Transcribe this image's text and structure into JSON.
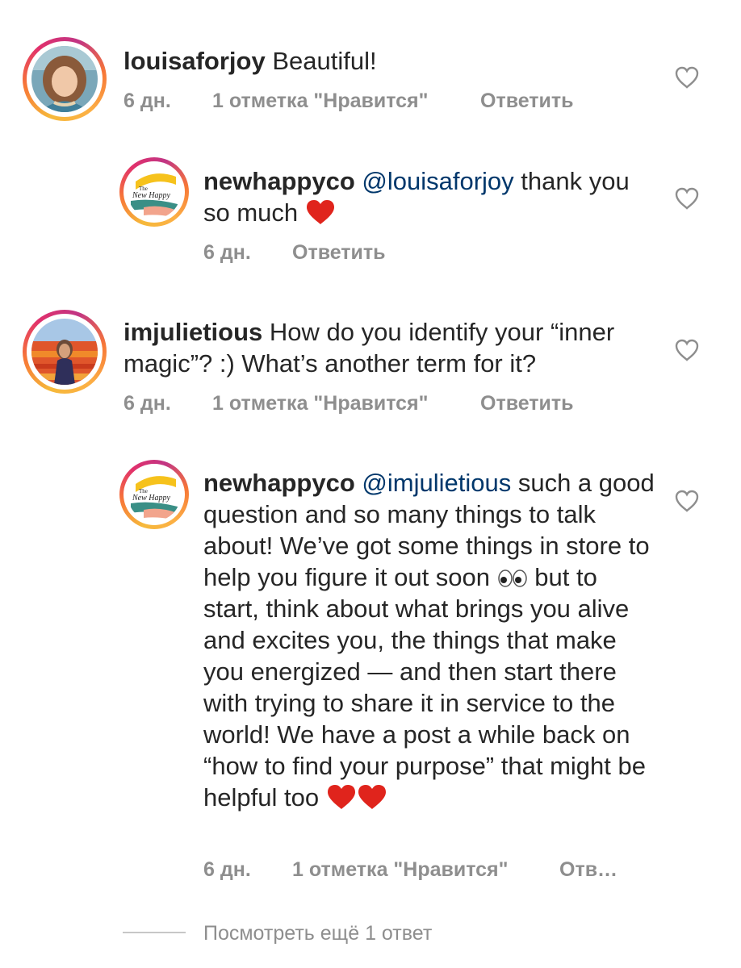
{
  "colors": {
    "text": "#262626",
    "muted": "#8e8e8e",
    "mention": "#00376b",
    "heart_red": "#e0241c"
  },
  "comments": [
    {
      "username": "louisaforjoy",
      "text": "Beautiful!",
      "time": "6 дн.",
      "likes": "1 отметка \"Нравится\"",
      "reply": "Ответить",
      "avatar": "user-photo"
    },
    {
      "username": "newhappyco",
      "mention": "@louisaforjoy",
      "text": "thank you so much",
      "time": "6 дн.",
      "reply": "Ответить",
      "avatar": "brand-logo",
      "logo_text": {
        "the": "The",
        "brand": "New Happy"
      }
    },
    {
      "username": "imjulietious",
      "text": "How do you identify your “inner magic”? :) What’s another term for it?",
      "time": "6 дн.",
      "likes": "1 отметка \"Нравится\"",
      "reply": "Ответить",
      "avatar": "user-photo"
    },
    {
      "username": "newhappyco",
      "mention": "@imjulietious",
      "text_part1": "such a good question and so many things to talk about! We’ve got some things in store to help you figure it out soon",
      "text_part2": "but to start, think about what brings you alive and excites you, the things that make you energized — and then start there with trying to share it in service to the world! We have a post a while back on “how to find your purpose” that might be helpful too",
      "time": "6 дн.",
      "likes": "1 отметка \"Нравится\"",
      "reply": "Отв…",
      "avatar": "brand-logo",
      "logo_text": {
        "the": "The",
        "brand": "New Happy"
      }
    }
  ],
  "view_more": "Посмотреть ещё 1 ответ"
}
